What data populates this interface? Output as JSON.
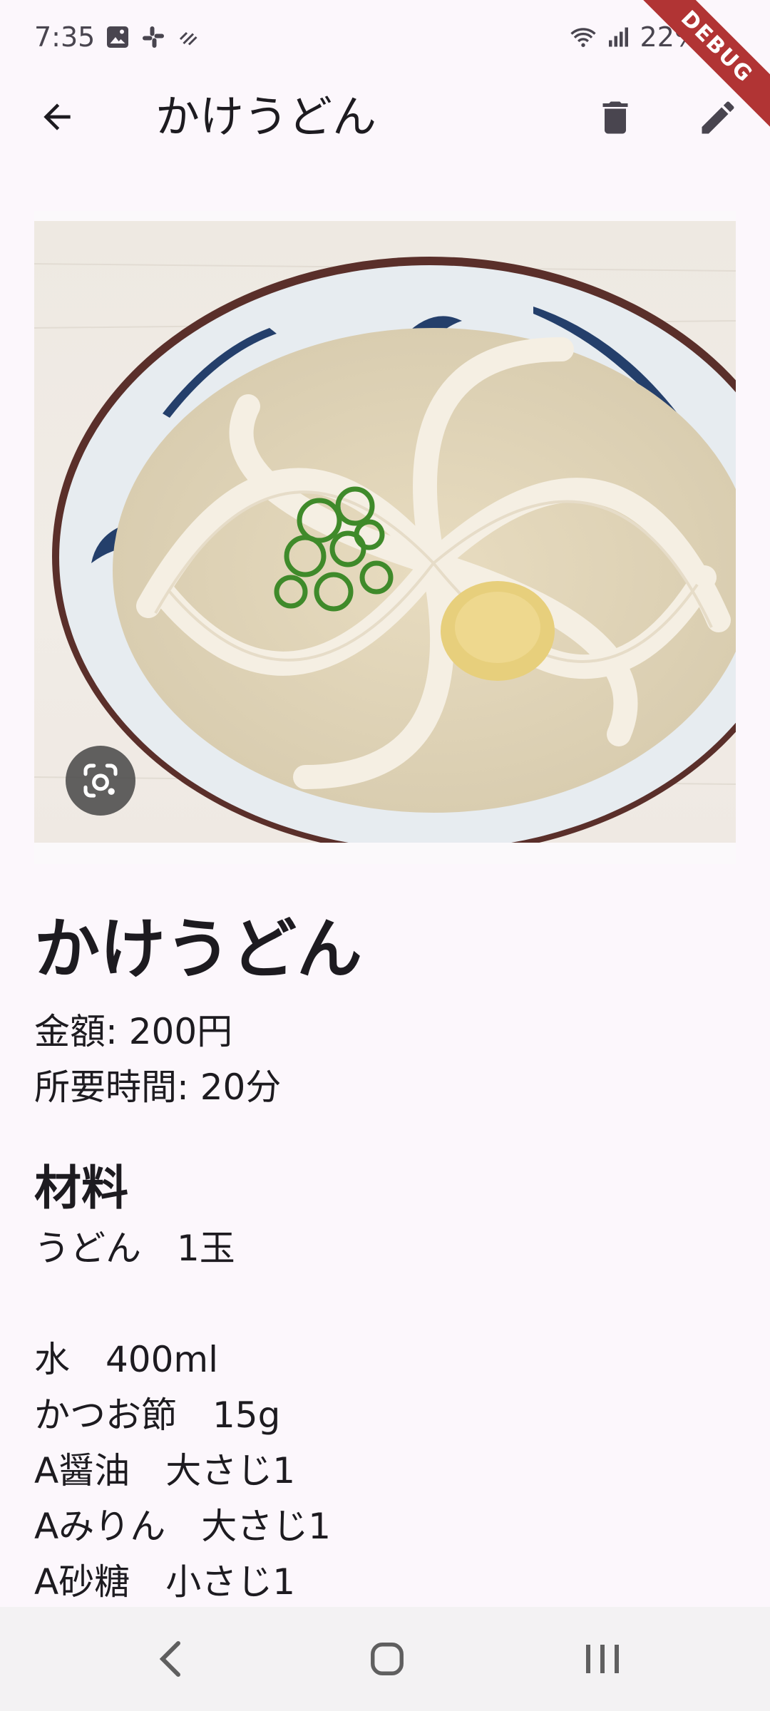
{
  "status_bar": {
    "time": "7:35",
    "battery": "22%",
    "icons": [
      "image-icon",
      "slack-icon",
      "signal-strength-icon",
      "wifi-icon",
      "cell-signal-icon",
      "battery-icon"
    ]
  },
  "debug_banner": "DEBUG",
  "app_bar": {
    "title": "かけうどん",
    "back_icon": "arrow-back-icon",
    "delete_icon": "trash-icon",
    "edit_icon": "pencil-icon"
  },
  "photo": {
    "description_icon": "google-lens-icon"
  },
  "recipe": {
    "title": "かけうどん",
    "price_line": "金額: 200円",
    "time_line": "所要時間: 20分",
    "ingredients_title": "材料",
    "ingredients": [
      "うどん　1玉",
      "",
      "水　400ml",
      "かつお節　15g",
      "A醤油　大さじ1",
      "Aみりん　大さじ1",
      "A砂糖　小さじ1"
    ]
  },
  "nav_bar": {
    "back_icon": "nav-back-icon",
    "home_icon": "nav-home-icon",
    "recents_icon": "nav-recents-icon"
  },
  "colors": {
    "background": "#fcf7fc",
    "text": "#1d1b20",
    "debug": "#b13434",
    "nav_bar": "#f3f2f3"
  }
}
